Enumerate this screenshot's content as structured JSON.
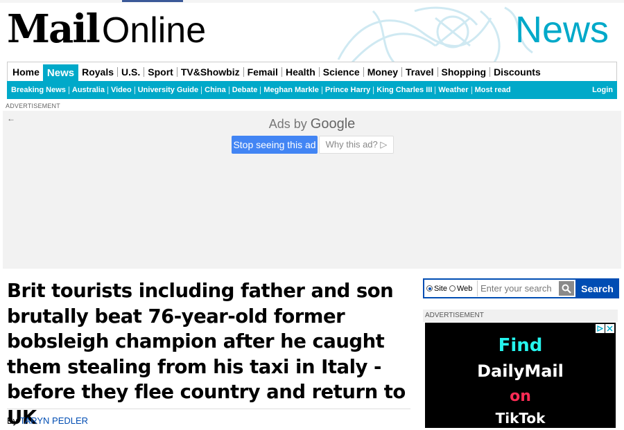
{
  "brand": {
    "logo_mail": "Mail",
    "logo_online": "Online",
    "section": "News"
  },
  "nav": {
    "primary": [
      {
        "label": "Home",
        "active": false
      },
      {
        "label": "News",
        "active": true
      },
      {
        "label": "Royals",
        "active": false
      },
      {
        "label": "U.S.",
        "active": false
      },
      {
        "label": "Sport",
        "active": false
      },
      {
        "label": "TV&Showbiz",
        "active": false
      },
      {
        "label": "Femail",
        "active": false
      },
      {
        "label": "Health",
        "active": false
      },
      {
        "label": "Science",
        "active": false
      },
      {
        "label": "Money",
        "active": false
      },
      {
        "label": "Travel",
        "active": false
      },
      {
        "label": "Shopping",
        "active": false
      },
      {
        "label": "Discounts",
        "active": false
      }
    ],
    "secondary": [
      "Breaking News",
      "Australia",
      "Video",
      "University Guide",
      "China",
      "Debate",
      "Meghan Markle",
      "Prince Harry",
      "King Charles III",
      "Weather",
      "Most read"
    ],
    "login_label": "Login"
  },
  "ad_top": {
    "label": "ADVERTISEMENT",
    "ads_by": "Ads by",
    "google": "Google",
    "stop_label": "Stop seeing this ad",
    "why_label": "Why this ad? ▷"
  },
  "article": {
    "headline": "Brit tourists including father and son brutally beat 76-year-old former bobsleigh champion after he caught them stealing from his taxi in Italy - before they flee country and return to UK",
    "byline_prefix": "By",
    "author": "TARYN PEDLER"
  },
  "search": {
    "site_label": "Site",
    "web_label": "Web",
    "placeholder": "Enter your search",
    "button_label": "Search"
  },
  "side_ad": {
    "label": "ADVERTISEMENT",
    "line1": "Find",
    "line2": "DailyMail",
    "line3": "on",
    "line4": "TikTok"
  },
  "colors": {
    "accent": "#00a9c9",
    "link": "#004db3",
    "google_blue": "#4285f4"
  }
}
